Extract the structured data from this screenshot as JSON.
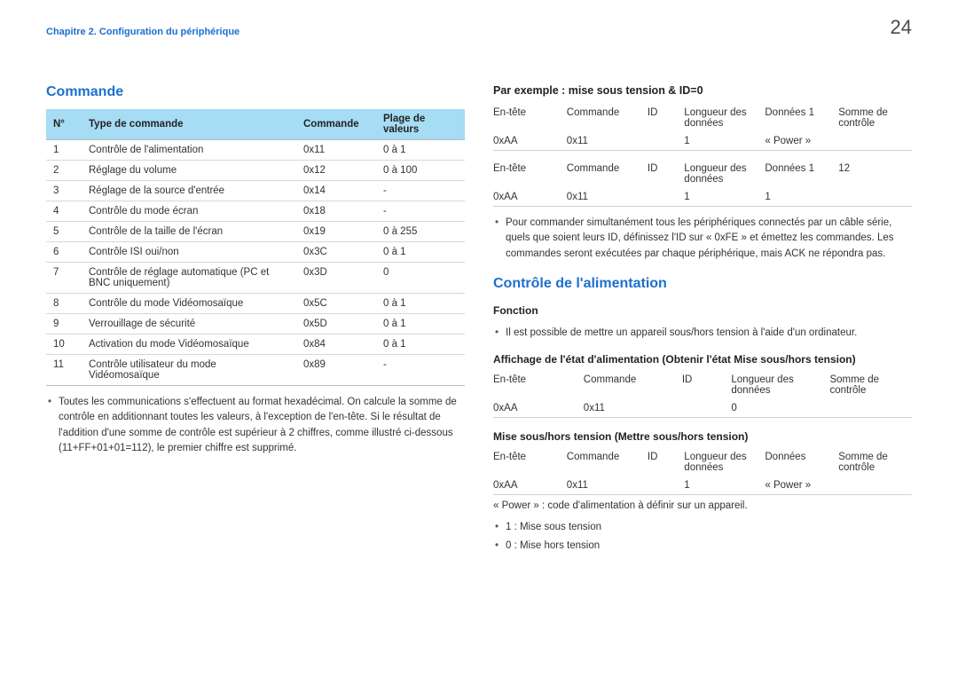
{
  "header": {
    "chapter": "Chapitre 2. Configuration du périphérique",
    "page": "24"
  },
  "left": {
    "title": "Commande",
    "cols": [
      "N°",
      "Type de commande",
      "Commande",
      "Plage de valeurs"
    ],
    "rows": [
      [
        "1",
        "Contrôle de l'alimentation",
        "0x11",
        "0 à 1"
      ],
      [
        "2",
        "Réglage du volume",
        "0x12",
        "0 à 100"
      ],
      [
        "3",
        "Réglage de la source d'entrée",
        "0x14",
        "-"
      ],
      [
        "4",
        "Contrôle du mode écran",
        "0x18",
        "-"
      ],
      [
        "5",
        "Contrôle de la taille de l'écran",
        "0x19",
        "0 à 255"
      ],
      [
        "6",
        "Contrôle ISI oui/non",
        "0x3C",
        "0 à 1"
      ],
      [
        "7",
        "Contrôle de réglage automatique (PC et BNC uniquement)",
        "0x3D",
        "0"
      ],
      [
        "8",
        "Contrôle du mode Vidéomosaïque",
        "0x5C",
        "0 à 1"
      ],
      [
        "9",
        "Verrouillage de sécurité",
        "0x5D",
        "0 à 1"
      ],
      [
        "10",
        "Activation du mode Vidéomosaïque",
        "0x84",
        "0 à 1"
      ],
      [
        "11",
        "Contrôle utilisateur du mode Vidéomosaïque",
        "0x89",
        "-"
      ]
    ],
    "note": "Toutes les communications s'effectuent au format hexadécimal. On calcule la somme de contrôle en additionnant toutes les valeurs, à l'exception de l'en-tête. Si le résultat de l'addition d'une somme de contrôle est supérieur à 2 chiffres, comme illustré ci-dessous (11+FF+01+01=112), le premier chiffre est supprimé."
  },
  "right": {
    "exTitle": "Par exemple : mise sous tension & ID=0",
    "ex1h": [
      "En-tête",
      "Commande",
      "ID",
      "Longueur des données",
      "Données 1",
      "Somme de contrôle"
    ],
    "ex1v": [
      "0xAA",
      "0x11",
      "",
      "1",
      "« Power »",
      ""
    ],
    "ex2h": [
      "En-tête",
      "Commande",
      "ID",
      "Longueur des données",
      "Données 1",
      "12"
    ],
    "ex2v": [
      "0xAA",
      "0x11",
      "",
      "1",
      "1",
      ""
    ],
    "note": "Pour commander simultanément tous les périphériques connectés par un câble série, quels que soient leurs ID, définissez l'ID sur « 0xFE » et émettez les commandes. Les commandes seront exécutées par chaque périphérique, mais ACK ne répondra pas.",
    "ctrlTitle": "Contrôle de l'alimentation",
    "fnTitle": "Fonction",
    "fnText": "Il est possible de mettre un appareil sous/hors tension à l'aide d'un ordinateur.",
    "getTitle": "Affichage de l'état d'alimentation (Obtenir l'état Mise sous/hors tension)",
    "getH": [
      "En-tête",
      "Commande",
      "ID",
      "Longueur des données",
      "Somme de contrôle"
    ],
    "getV": [
      "0xAA",
      "0x11",
      "",
      "0",
      ""
    ],
    "setTitle": "Mise sous/hors tension (Mettre sous/hors tension)",
    "setH": [
      "En-tête",
      "Commande",
      "ID",
      "Longueur des données",
      "Données",
      "Somme de contrôle"
    ],
    "setV": [
      "0xAA",
      "0x11",
      "",
      "1",
      "« Power »",
      ""
    ],
    "powerNote": "« Power » : code d'alimentation à définir sur un appareil.",
    "pw1": "1 : Mise sous tension",
    "pw0": "0 : Mise hors tension"
  }
}
